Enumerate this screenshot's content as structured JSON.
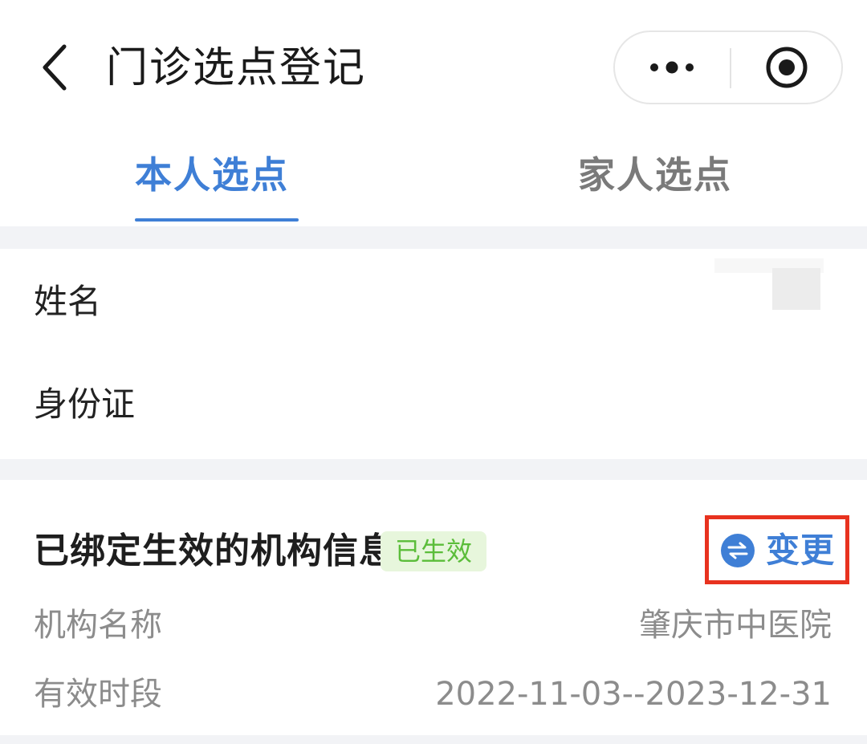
{
  "nav": {
    "title": "门诊选点登记",
    "back_icon": "chevron-left-icon",
    "more_icon": "more-dots-icon",
    "close_icon": "target-close-icon"
  },
  "tabs": [
    {
      "label": "本人选点",
      "active": true
    },
    {
      "label": "家人选点",
      "active": false
    }
  ],
  "personal_info": {
    "name_label": "姓名",
    "id_label": "身份证"
  },
  "institution": {
    "section_title": "已绑定生效的机构信息",
    "status_badge": "已生效",
    "change_label": "变更",
    "change_icon": "swap-arrows-icon",
    "rows": [
      {
        "label": "机构名称",
        "value": "肇庆市中医院"
      },
      {
        "label": "有效时段",
        "value": "2022-11-03--2023-12-31"
      }
    ]
  },
  "colors": {
    "accent": "#3f7fd6",
    "status_green": "#5bbd3a",
    "status_green_bg": "#e7f6dc",
    "highlight_red": "#e8321f",
    "muted_text": "#8c8c8c",
    "section_gap": "#f2f3f6"
  }
}
